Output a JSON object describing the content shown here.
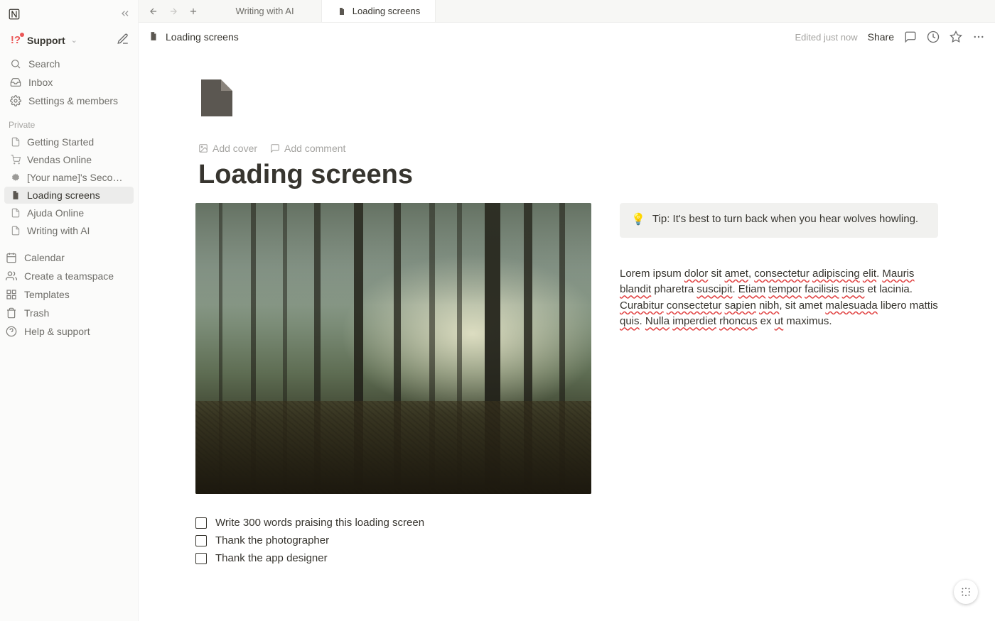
{
  "sidebar": {
    "workspace": {
      "icon_text": "!?",
      "name": "Support"
    },
    "nav": {
      "search": "Search",
      "inbox": "Inbox",
      "settings": "Settings & members"
    },
    "private_label": "Private",
    "pages": [
      {
        "id": "getting-started",
        "label": "Getting Started",
        "icon": "doc"
      },
      {
        "id": "vendas-online",
        "label": "Vendas Online",
        "icon": "cart"
      },
      {
        "id": "second-brain",
        "label": "[Your name]'s Second Brain",
        "icon": "gear-bold"
      },
      {
        "id": "loading-screens",
        "label": "Loading screens",
        "icon": "doc-dark",
        "active": true
      },
      {
        "id": "ajuda-online",
        "label": "Ajuda Online",
        "icon": "doc"
      },
      {
        "id": "writing-with-ai",
        "label": "Writing with AI",
        "icon": "doc"
      }
    ],
    "utility": [
      {
        "id": "calendar",
        "label": "Calendar"
      },
      {
        "id": "teamspace",
        "label": "Create a teamspace"
      },
      {
        "id": "templates",
        "label": "Templates"
      },
      {
        "id": "trash",
        "label": "Trash"
      },
      {
        "id": "help",
        "label": "Help & support"
      }
    ]
  },
  "tabs": [
    {
      "id": "writing-with-ai",
      "label": "Writing with AI",
      "active": false
    },
    {
      "id": "loading-screens",
      "label": "Loading screens",
      "active": true
    }
  ],
  "breadcrumb": {
    "title": "Loading screens"
  },
  "topbar": {
    "edited": "Edited just now",
    "share": "Share"
  },
  "page": {
    "cover_actions": {
      "add_cover": "Add cover",
      "add_comment": "Add comment"
    },
    "title": "Loading screens",
    "callout": {
      "emoji": "💡",
      "text": "Tip: It's best to turn back when you hear wolves howling."
    },
    "todos": [
      "Write 300 words praising this loading screen",
      "Thank the photographer",
      "Thank the app designer"
    ],
    "paragraph_parts": {
      "p0": "Lorem ipsum ",
      "w0": "dolor",
      "p1": " sit ",
      "w1": "amet",
      "p2": ", ",
      "w2": "consectetur",
      "p3": " ",
      "w3": "adipiscing",
      "p4": " ",
      "w4": "elit",
      "p5": ". ",
      "w5": "Mauris",
      "p6": " ",
      "w6": "blandit",
      "p7": " pharetra ",
      "w7": "suscipit",
      "p8": ". ",
      "w8": "Etiam",
      "p9": " ",
      "w9": "tempor",
      "p10": " ",
      "w10": "facilisis",
      "p11": " ",
      "w11": "risus",
      "p12": " et lacinia. ",
      "w12": "Curabitur",
      "p13": " ",
      "w13": "consectetur",
      "p14": " ",
      "w14": "sapien",
      "p15": " ",
      "w15": "nibh",
      "p16": ", sit amet ",
      "w16": "malesuada",
      "p17": " libero mattis ",
      "w17": "quis",
      "p18": ". ",
      "w18": "Nulla",
      "p19": " ",
      "w19": "imperdiet",
      "p20": " ",
      "w20": "rhoncus",
      "p21": " ex ",
      "w21": "ut",
      "p22": " maximus."
    }
  }
}
